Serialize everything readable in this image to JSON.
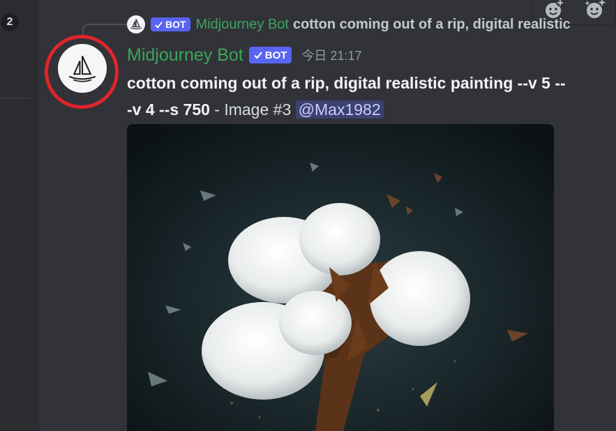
{
  "sidebar": {
    "badge_count": "2"
  },
  "toolbar": {
    "actions": [
      {
        "icon": "add-reaction-icon"
      },
      {
        "icon": "super-reaction-icon"
      }
    ]
  },
  "reply": {
    "bot_tag": "BOT",
    "author": "Midjourney Bot",
    "text": "cotton coming out of a rip, digital realistic"
  },
  "message": {
    "author": "Midjourney Bot",
    "bot_tag": "BOT",
    "timestamp": "今日 21:17",
    "line1": "cotton coming out of a rip, digital realistic painting --v 5 --",
    "line2_bold": "-v 4 --s 750",
    "line2_suffix": " - Image #3 ",
    "mention": "@Max1982"
  },
  "colors": {
    "background": "#313338",
    "author_green": "#3ba55c",
    "bot_tag": "#5865f2",
    "highlight_ring": "#e0242c",
    "mention_bg": "#3c4270"
  }
}
